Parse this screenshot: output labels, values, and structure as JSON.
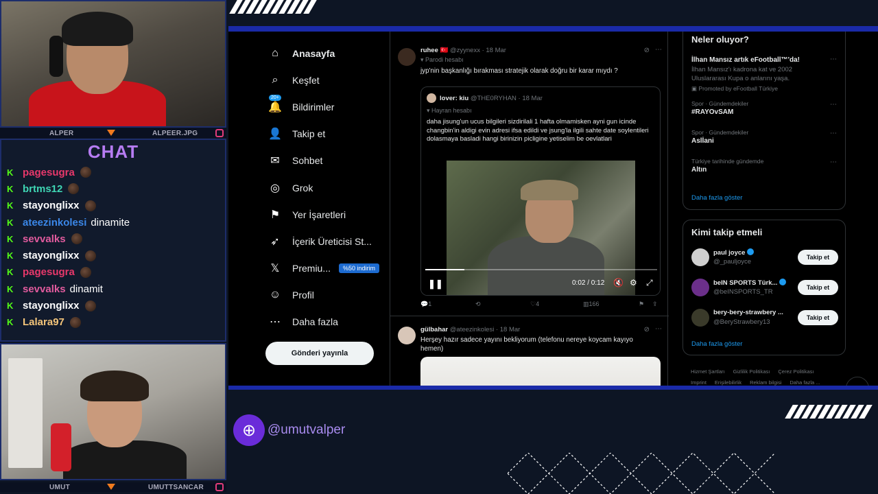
{
  "overlay": {
    "cam_top_label_left": "ALPER",
    "cam_top_label_right": "ALPEER.JPG",
    "cam_bottom_label_left": "UMUT",
    "cam_bottom_label_right": "UMUTTSANCAR",
    "chat_title": "CHAT",
    "handle": "@umutvalper",
    "accent_color": "#b67cf2",
    "kick_color": "#53fc18"
  },
  "chat": [
    {
      "user": "pagesugra",
      "color": "#e8386b",
      "message": "",
      "emote": true
    },
    {
      "user": "brtms12",
      "color": "#3fd6b4",
      "message": "",
      "emote": true
    },
    {
      "user": "stayonglixx",
      "color": "#ffffff",
      "message": "",
      "emote": true
    },
    {
      "user": "ateezinkolesi",
      "color": "#3b87e8",
      "message": "dinamite",
      "emote": false
    },
    {
      "user": "sevvalks",
      "color": "#e25b9e",
      "message": "",
      "emote": true
    },
    {
      "user": "stayonglixx",
      "color": "#ffffff",
      "message": "",
      "emote": true
    },
    {
      "user": "pagesugra",
      "color": "#e8386b",
      "message": "",
      "emote": true
    },
    {
      "user": "sevvalks",
      "color": "#e25b9e",
      "message": "dinamit",
      "emote": false
    },
    {
      "user": "stayonglixx",
      "color": "#ffffff",
      "message": "",
      "emote": true
    },
    {
      "user": "Lalara97",
      "color": "#f4c57a",
      "message": "",
      "emote": true
    }
  ],
  "nav": [
    {
      "label": "Anasayfa",
      "icon": "home-icon",
      "glyph": "⌂"
    },
    {
      "label": "Keşfet",
      "icon": "search-icon",
      "glyph": "⌕"
    },
    {
      "label": "Bildirimler",
      "icon": "bell-icon",
      "glyph": "♫"
    },
    {
      "label": "Takip et",
      "icon": "add-user-icon",
      "glyph": "👤"
    },
    {
      "label": "Sohbet",
      "icon": "mail-icon",
      "glyph": "✉"
    },
    {
      "label": "Grok",
      "icon": "grok-icon",
      "glyph": "◎"
    },
    {
      "label": "Yer İşaretleri",
      "icon": "bookmark-icon",
      "glyph": "⚑"
    },
    {
      "label": "İçerik Üreticisi St...",
      "icon": "rocket-icon",
      "glyph": "➶"
    },
    {
      "label": "Premiu...",
      "icon": "x-logo-icon",
      "glyph": "𝕏"
    },
    {
      "label": "Profil",
      "icon": "profile-icon",
      "glyph": "☺"
    },
    {
      "label": "Daha fazla",
      "icon": "more-icon",
      "glyph": "⋯"
    }
  ],
  "notifications_badge": "20+",
  "premium_pill": "%50 indirim",
  "post_button": "Gönderi yayınla",
  "tweet1": {
    "name": "ruhee",
    "meta": "@zyynexx · 18 Mar",
    "tag": "Parodi hesabı",
    "text": "jyp'nin başkanlığı bırakması stratejik olarak doğru bir karar mıydı ?",
    "quote": {
      "name": "lover: kiu",
      "meta": "@THE0RYHAN · 18 Mar",
      "tag": "Hayran hesabı",
      "text": "daha jisung'un ucus bilgileri sizdirilali 1 hafta olmamisken ayni gun icinde changbin'in aldigi evin adresi ifsa edildi ve jsung'la ilgili sahte date soylentileri dolasmaya basladi hangi birinizin picligine yetiselim be oevlatlari"
    },
    "video_time": "0:02 / 0:12",
    "video_progress": 0.17,
    "replies": "1",
    "likes": "4",
    "views": "166"
  },
  "tweet2": {
    "name": "gülbahar",
    "meta": "@ateezinkolesi · 18 Mar",
    "text": "Herşey hazır sadece yayını bekliyorum (telefonu nereye koycam kayıyo hemen)"
  },
  "trends": {
    "title": "Neler oluyor?",
    "promo_name": "İlhan Mansız artık eFootball™'da!",
    "promo_desc": "İlhan Mansız'ı kadrona kat ve 2002 Uluslararası Kupa o anlarını yaşa.",
    "promo_by": "Promoted by eFootball Türkiye",
    "items": [
      {
        "meta": "Spor · Gündemdekiler",
        "name": "#RAYOvSAM"
      },
      {
        "meta": "Spor · Gündemdekiler",
        "name": "Aslİani"
      },
      {
        "meta": "Türkiye tarihinde gündemde",
        "name": "Altın"
      }
    ],
    "show_more": "Daha fazla göster"
  },
  "who_to_follow": {
    "title": "Kimi takip etmeli",
    "items": [
      {
        "name": "paul joyce",
        "handle": "@_pauljoyce",
        "verified": true,
        "button": "Takip et"
      },
      {
        "name": "beIN SPORTS Türk...",
        "handle": "@beINSPORTS_TR",
        "verified": true,
        "button": "Takip et"
      },
      {
        "name": "bery-bery-strawbery ...",
        "handle": "@BeryStrawbery13",
        "verified": false,
        "button": "Takip et"
      }
    ],
    "show_more": "Daha fazla göster"
  },
  "footer": {
    "line1": [
      "Hizmet Şartları",
      "Gizlilik Politikası",
      "Çerez Politikası"
    ],
    "line2": [
      "Imprint",
      "Erişilebilirlik",
      "Reklam bilgisi",
      "Daha fazla ..."
    ]
  }
}
